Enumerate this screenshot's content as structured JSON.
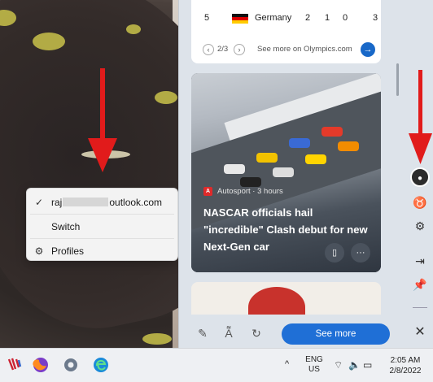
{
  "profile_menu": {
    "email_prefix": "raj",
    "email_suffix": "outlook.com",
    "switch_label": "Switch",
    "profiles_label": "Profiles"
  },
  "medals": {
    "rank": "5",
    "country": "Germany",
    "gold": "2",
    "silver": "1",
    "bronze": "0",
    "total": "3",
    "page": "2/3",
    "see_more": "See more on Olympics.com"
  },
  "news": {
    "source": "Autosport",
    "age": "3 hours",
    "source_logo": "A",
    "headline": "NASCAR officials hail \"incredible\" Clash debut for new Next-Gen car"
  },
  "bottom_bar": {
    "see_more_label": "See more"
  },
  "taskbar": {
    "lang_top": "ENG",
    "lang_bottom": "US",
    "time": "2:05 AM",
    "date": "2/8/2022"
  },
  "colors": {
    "accent": "#1f6fd6",
    "arrow": "#e11b1b"
  },
  "icons": {
    "rail": [
      "profile-avatar-icon",
      "trophy-icon",
      "gear-icon",
      "pin-right-icon",
      "pin-icon",
      "minimize-icon",
      "close-icon"
    ]
  }
}
